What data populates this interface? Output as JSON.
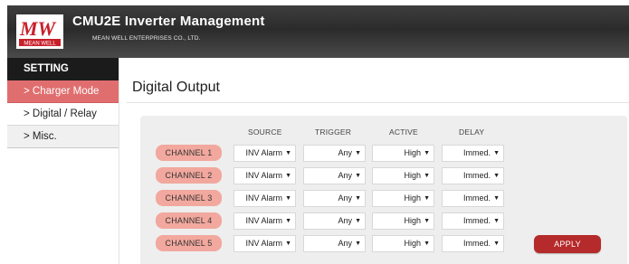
{
  "header": {
    "logo_text": "MW",
    "logo_sub": "MEAN WELL",
    "title": "CMU2E Inverter Management",
    "company": "MEAN WELL ENTERPRISES CO., LTD."
  },
  "sidebar": {
    "heading": "SETTING",
    "items": [
      {
        "label": "> Charger Mode",
        "active": true
      },
      {
        "label": "> Digital / Relay",
        "active": false
      },
      {
        "label": "> Misc.",
        "active": false
      }
    ]
  },
  "page_title": "Digital Output",
  "columns": {
    "source": "SOURCE",
    "trigger": "TRIGGER",
    "active": "ACTIVE",
    "delay": "DELAY"
  },
  "channels": [
    {
      "label": "CHANNEL 1",
      "source": "INV Alarm",
      "trigger": "Any",
      "active": "High",
      "delay": "Immed."
    },
    {
      "label": "CHANNEL 2",
      "source": "INV Alarm",
      "trigger": "Any",
      "active": "High",
      "delay": "Immed."
    },
    {
      "label": "CHANNEL 3",
      "source": "INV Alarm",
      "trigger": "Any",
      "active": "High",
      "delay": "Immed."
    },
    {
      "label": "CHANNEL 4",
      "source": "INV Alarm",
      "trigger": "Any",
      "active": "High",
      "delay": "Immed."
    },
    {
      "label": "CHANNEL 5",
      "source": "INV Alarm",
      "trigger": "Any",
      "active": "High",
      "delay": "Immed."
    }
  ],
  "apply_label": "APPLY",
  "colors": {
    "accent": "#b52a2a",
    "channel_badge": "#f2a89e",
    "nav_active": "#e06e6e",
    "header_bg": "#333333"
  }
}
